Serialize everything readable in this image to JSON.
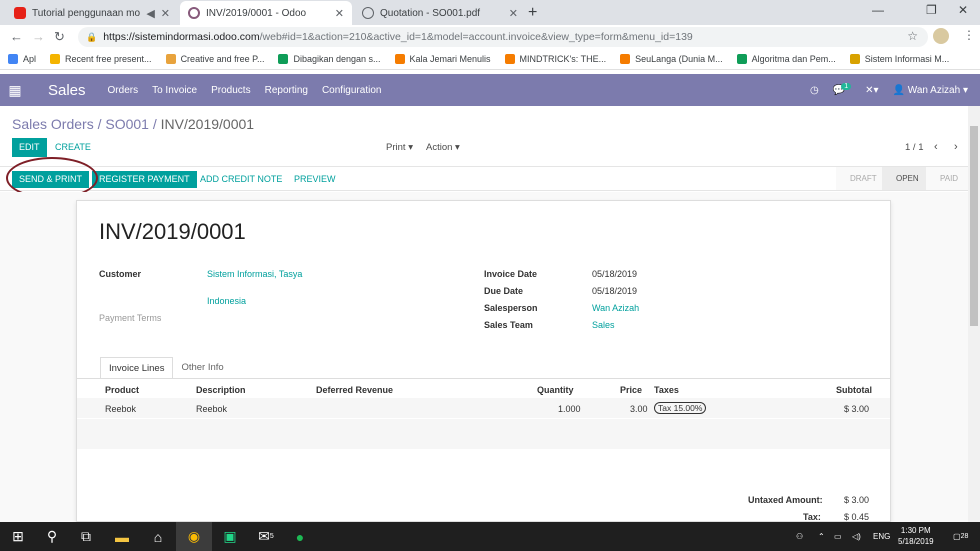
{
  "browser": {
    "tabs": [
      {
        "label": "Tutorial penggunaan modul",
        "icon": "youtube-icon"
      },
      {
        "label": "INV/2019/0001 - Odoo",
        "icon": "odoo-icon"
      },
      {
        "label": "Quotation - SO001.pdf",
        "icon": "globe-icon"
      }
    ],
    "url_host": "https://sistemindormasi.odoo.com",
    "url_path": "/web#id=1&action=210&active_id=1&model=account.invoice&view_type=form&menu_id=139",
    "bookmarks": [
      {
        "label": "Apl",
        "color": "#4285f4"
      },
      {
        "label": "Recent free present...",
        "color": "#f4b400"
      },
      {
        "label": "Creative and free P...",
        "color": "#e8a33d"
      },
      {
        "label": "Dibagikan dengan s...",
        "color": "#0f9d58"
      },
      {
        "label": "Kala Jemari Menulis",
        "color": "#f57c00"
      },
      {
        "label": "MINDTRICK's: THE...",
        "color": "#f57c00"
      },
      {
        "label": "SeuLanga (Dunia M...",
        "color": "#f57c00"
      },
      {
        "label": "Algoritma dan Pem...",
        "color": "#0f9d58"
      },
      {
        "label": "Sistem Informasi M...",
        "color": "#d8a200"
      }
    ]
  },
  "odoo": {
    "app": "Sales",
    "menu": [
      "Orders",
      "To Invoice",
      "Products",
      "Reporting",
      "Configuration"
    ],
    "message_count": "1",
    "user": "Wan Azizah",
    "accent": "#7c7bad",
    "primary": "#00a09d"
  },
  "breadcrumb": {
    "root": "Sales Orders",
    "sep": "/",
    "mid": "SO001",
    "current": "INV/2019/0001"
  },
  "controls": {
    "edit": "EDIT",
    "create": "CREATE",
    "print": "Print",
    "action": "Action",
    "pager": "1 / 1"
  },
  "statusbar": {
    "send_print": "SEND & PRINT",
    "register_payment": "REGISTER PAYMENT",
    "add_credit_note": "ADD CREDIT NOTE",
    "preview": "PREVIEW",
    "stages": [
      "DRAFT",
      "OPEN",
      "PAID"
    ],
    "active_stage": "OPEN"
  },
  "invoice": {
    "number": "INV/2019/0001",
    "customer_label": "Customer",
    "customer": "Sistem Informasi, Tasya",
    "country": "Indonesia",
    "payment_terms_label": "Payment Terms",
    "invoice_date_label": "Invoice Date",
    "invoice_date": "05/18/2019",
    "due_date_label": "Due Date",
    "due_date": "05/18/2019",
    "salesperson_label": "Salesperson",
    "salesperson": "Wan Azizah",
    "sales_team_label": "Sales Team",
    "sales_team": "Sales",
    "tabs": [
      "Invoice Lines",
      "Other Info"
    ],
    "columns": [
      "Product",
      "Description",
      "Deferred Revenue",
      "Quantity",
      "Price",
      "Taxes",
      "Subtotal"
    ],
    "lines": [
      {
        "product": "Reebok",
        "description": "Reebok",
        "quantity": "1.000",
        "price": "3.00",
        "tax": "Tax 15.00%",
        "subtotal": "$ 3.00"
      }
    ],
    "untaxed_label": "Untaxed Amount:",
    "untaxed": "$ 3.00",
    "tax_label": "Tax:",
    "tax": "$ 0.45"
  },
  "taskbar": {
    "lang": "ENG",
    "time": "1:30 PM",
    "date": "5/18/2019",
    "notif_count": "28",
    "mail_count": "5"
  }
}
